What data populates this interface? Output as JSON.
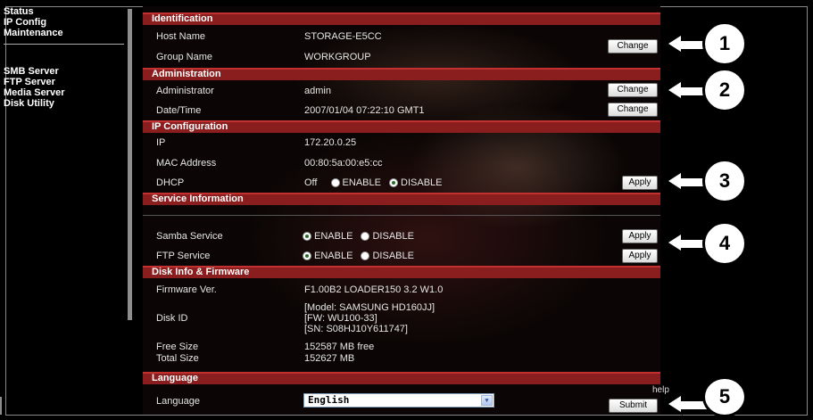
{
  "nav": {
    "group1": [
      "Status",
      "IP Config",
      "Maintenance"
    ],
    "group2": [
      "SMB Server",
      "FTP Server",
      "Media Server",
      "Disk Utility"
    ]
  },
  "sections": {
    "identification": "Identification",
    "administration": "Administration",
    "ip_config": "IP Configuration",
    "service_info": "Service Information",
    "disk_info": "Disk Info & Firmware",
    "language": "Language"
  },
  "identification": {
    "host_label": "Host Name",
    "host_value": "STORAGE-E5CC",
    "group_label": "Group Name",
    "group_value": "WORKGROUP"
  },
  "administration": {
    "admin_label": "Administrator",
    "admin_value": "admin",
    "datetime_label": "Date/Time",
    "datetime_value": "2007/01/04 07:22:10 GMT1"
  },
  "ip": {
    "ip_label": "IP",
    "ip_value": "172.20.0.25",
    "mac_label": "MAC Address",
    "mac_value": "00:80:5a:00:e5:cc",
    "dhcp_label": "DHCP",
    "dhcp_state": "Off",
    "enable": "ENABLE",
    "disable": "DISABLE"
  },
  "services": {
    "samba_label": "Samba Service",
    "ftp_label": "FTP Service",
    "enable": "ENABLE",
    "disable": "DISABLE"
  },
  "disk": {
    "fw_label": "Firmware Ver.",
    "fw_value": "F1.00B2 LOADER150 3.2 W1.0",
    "diskid_label": "Disk ID",
    "diskid_model": "[Model: SAMSUNG HD160JJ]",
    "diskid_fw": "[FW: WU100-33]",
    "diskid_sn": "[SN: S08HJ10Y611747]",
    "free_label": "Free Size",
    "free_value": "152587 MB free",
    "total_label": "Total Size",
    "total_value": "152627 MB"
  },
  "language": {
    "label": "Language",
    "selected": "English",
    "help": "help"
  },
  "buttons": {
    "change": "Change",
    "apply": "Apply",
    "submit": "Submit"
  },
  "callouts": [
    "1",
    "2",
    "3",
    "4",
    "5"
  ]
}
